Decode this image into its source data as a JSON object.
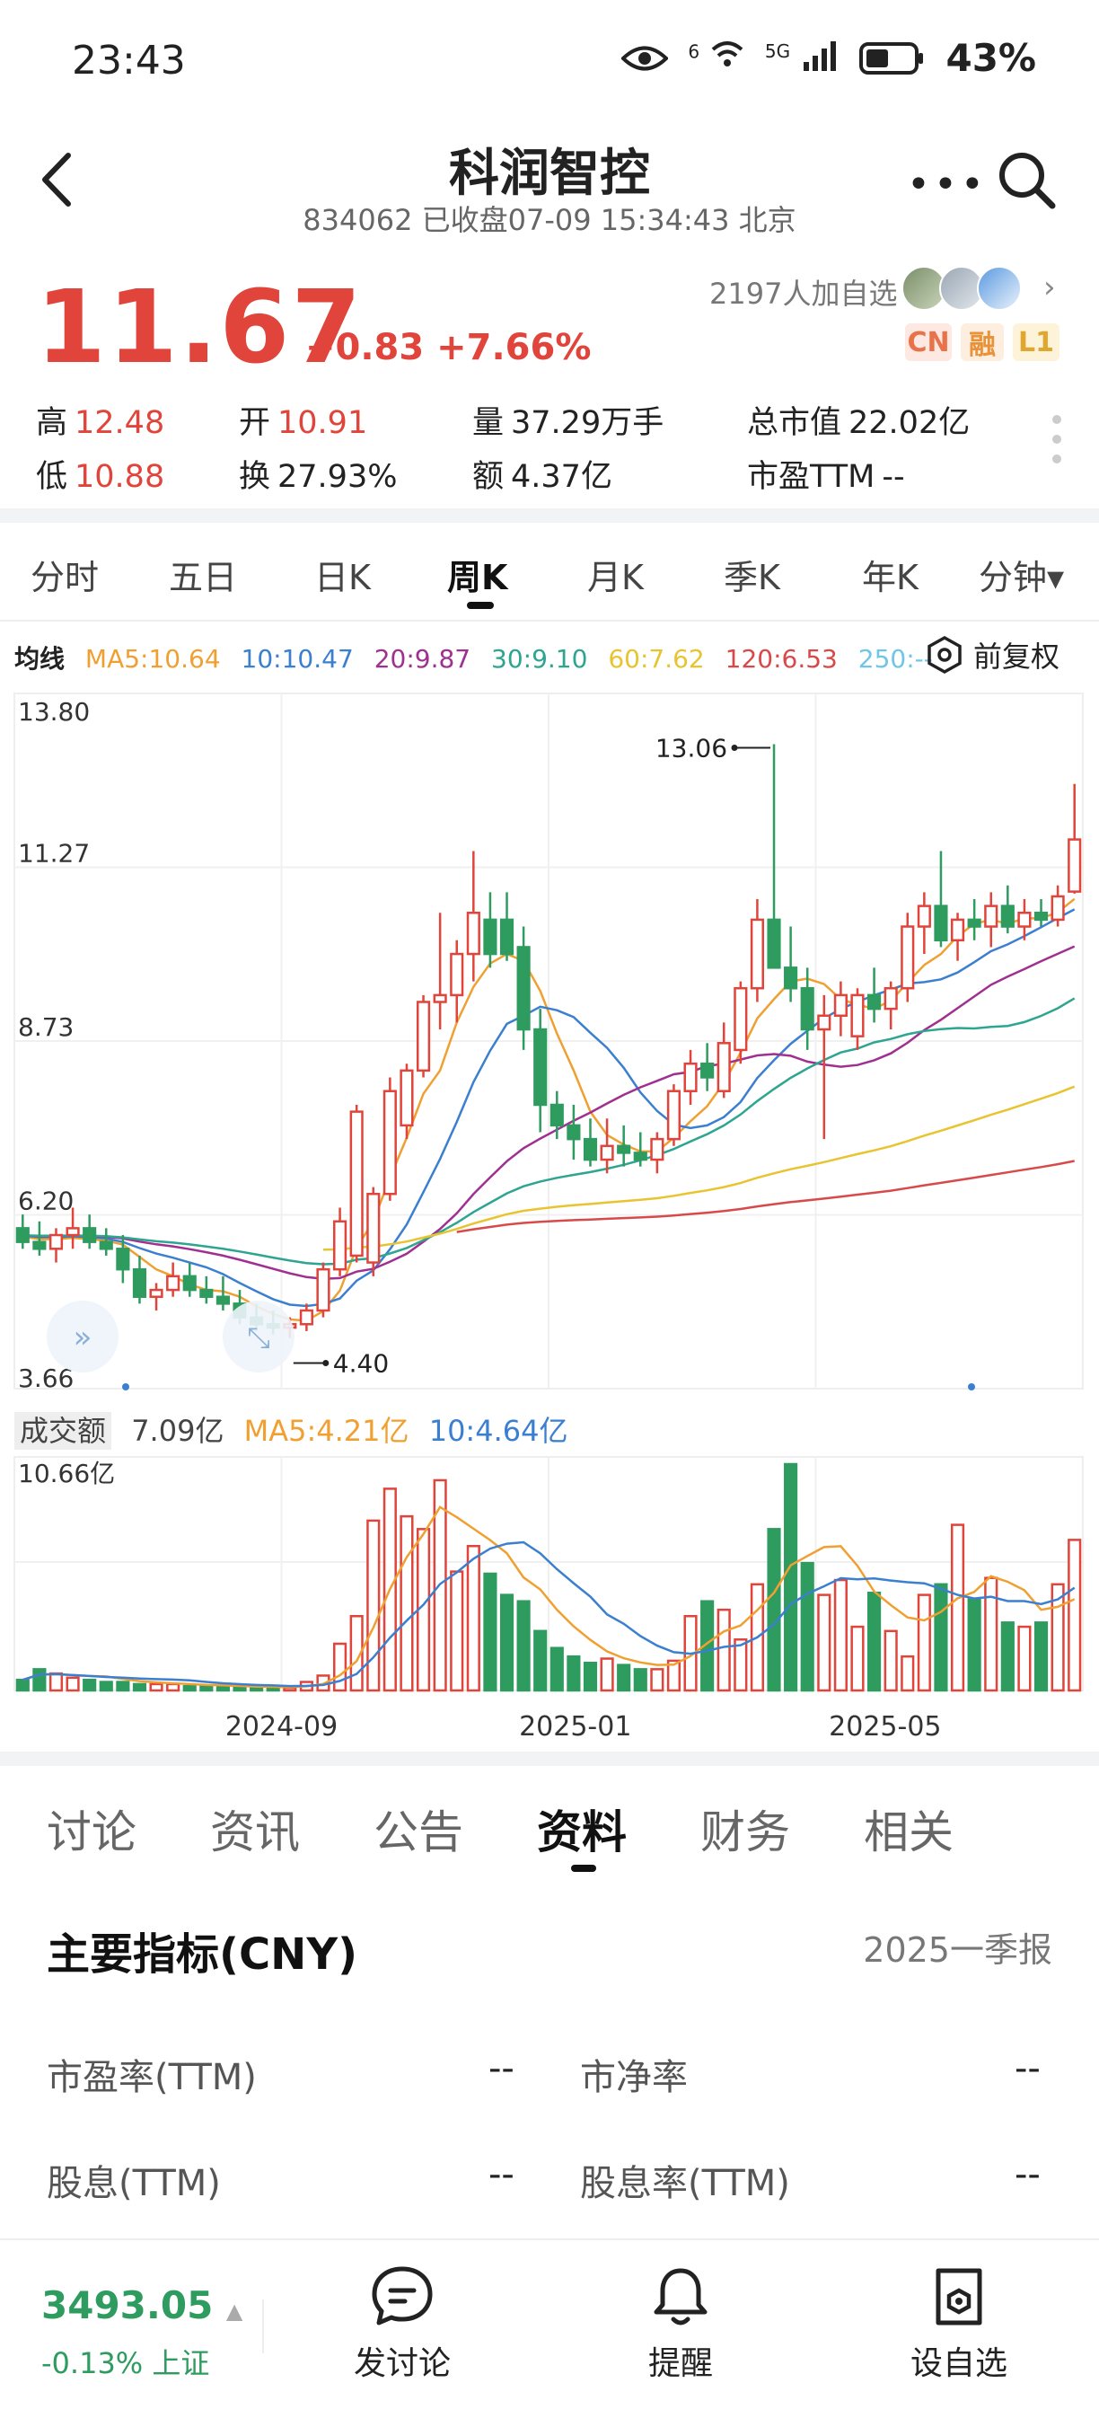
{
  "status_bar": {
    "time": "23:43",
    "battery": "43%",
    "network": "5G",
    "wifi_tag": "6"
  },
  "header": {
    "title": "科润智控",
    "subtitle": "834062 已收盘07-09 15:34:43 北京"
  },
  "quote": {
    "price": "11.67",
    "change": "+0.83 +7.66%",
    "followers": "2197人加自选",
    "tags": [
      "CN",
      "融",
      "L1"
    ],
    "stats": {
      "high_label": "高",
      "high": "12.48",
      "low_label": "低",
      "low": "10.88",
      "open_label": "开",
      "open": "10.91",
      "turnover_label": "换",
      "turnover": "27.93%",
      "volume_label": "量",
      "volume": "37.29万手",
      "amount_label": "额",
      "amount": "4.37亿",
      "mktcap_label": "总市值",
      "mktcap": "22.02亿",
      "pe_label": "市盈TTM",
      "pe": "--"
    }
  },
  "period_tabs": [
    "分时",
    "五日",
    "日K",
    "周K",
    "月K",
    "季K",
    "年K",
    "分钟▾"
  ],
  "active_period": "周K",
  "ma_legend": {
    "title": "均线",
    "items": [
      {
        "label": "MA5:10.64",
        "color": "#f0a030"
      },
      {
        "label": "10:10.47",
        "color": "#3b7fd0"
      },
      {
        "label": "20:9.87",
        "color": "#a03090"
      },
      {
        "label": "30:9.10",
        "color": "#2ea590"
      },
      {
        "label": "60:7.62",
        "color": "#e8c430"
      },
      {
        "label": "120:6.53",
        "color": "#d84a4a"
      },
      {
        "label": "250:--",
        "color": "#6fc6e6"
      }
    ],
    "adjust": "前复权"
  },
  "volume_legend": {
    "title": "成交额",
    "value": "7.09亿",
    "ma5": "MA5:4.21亿",
    "ma10": "10:4.64亿",
    "max_label": "10.66亿"
  },
  "chart_data": {
    "type": "candlestick",
    "price_axis": {
      "ticks": [
        "13.80",
        "11.27",
        "8.73",
        "6.20",
        "3.66"
      ],
      "ylim": [
        3.66,
        13.8
      ]
    },
    "x_ticks": [
      "2024-09",
      "2025-01",
      "2025-05"
    ],
    "annotations": {
      "max": "13.06",
      "min": "4.40"
    },
    "candles": [
      [
        6.0,
        6.2,
        5.7,
        5.8
      ],
      [
        5.8,
        6.1,
        5.6,
        5.7
      ],
      [
        5.7,
        6.0,
        5.5,
        5.9
      ],
      [
        5.9,
        6.3,
        5.7,
        6.0
      ],
      [
        6.0,
        6.2,
        5.7,
        5.8
      ],
      [
        5.8,
        6.0,
        5.6,
        5.7
      ],
      [
        5.7,
        5.9,
        5.2,
        5.4
      ],
      [
        5.4,
        5.6,
        4.9,
        5.0
      ],
      [
        5.0,
        5.2,
        4.8,
        5.1
      ],
      [
        5.1,
        5.5,
        5.0,
        5.3
      ],
      [
        5.3,
        5.5,
        5.0,
        5.1
      ],
      [
        5.1,
        5.3,
        4.9,
        5.0
      ],
      [
        5.0,
        5.3,
        4.8,
        4.9
      ],
      [
        4.9,
        5.1,
        4.6,
        4.7
      ],
      [
        4.7,
        4.9,
        4.5,
        4.6
      ],
      [
        4.6,
        4.8,
        4.45,
        4.55
      ],
      [
        4.55,
        4.7,
        4.4,
        4.6
      ],
      [
        4.6,
        4.9,
        4.5,
        4.8
      ],
      [
        4.8,
        5.5,
        4.7,
        5.4
      ],
      [
        5.4,
        6.3,
        5.3,
        6.1
      ],
      [
        5.6,
        7.8,
        5.5,
        7.7
      ],
      [
        5.5,
        6.6,
        5.3,
        6.5
      ],
      [
        6.5,
        8.2,
        6.4,
        8.0
      ],
      [
        7.5,
        8.4,
        7.3,
        8.3
      ],
      [
        8.3,
        9.4,
        8.2,
        9.3
      ],
      [
        9.3,
        10.6,
        8.9,
        9.4
      ],
      [
        9.4,
        10.2,
        9.0,
        10.0
      ],
      [
        10.0,
        11.5,
        9.6,
        10.6
      ],
      [
        10.5,
        10.9,
        9.8,
        10.0
      ],
      [
        10.5,
        10.9,
        9.9,
        10.0
      ],
      [
        10.1,
        10.4,
        8.6,
        8.9
      ],
      [
        8.9,
        9.2,
        7.4,
        7.8
      ],
      [
        7.8,
        8.0,
        7.3,
        7.5
      ],
      [
        7.5,
        7.8,
        7.0,
        7.3
      ],
      [
        7.3,
        7.6,
        6.9,
        7.0
      ],
      [
        7.0,
        7.6,
        6.8,
        7.2
      ],
      [
        7.2,
        7.5,
        6.9,
        7.1
      ],
      [
        7.1,
        7.4,
        6.9,
        7.0
      ],
      [
        7.0,
        7.4,
        6.8,
        7.3
      ],
      [
        7.3,
        8.1,
        7.2,
        8.0
      ],
      [
        8.0,
        8.6,
        7.8,
        8.4
      ],
      [
        8.4,
        8.7,
        8.0,
        8.2
      ],
      [
        8.0,
        9.0,
        7.9,
        8.7
      ],
      [
        8.6,
        9.6,
        8.4,
        9.5
      ],
      [
        9.5,
        10.8,
        9.3,
        10.5
      ],
      [
        10.5,
        13.06,
        9.9,
        9.8
      ],
      [
        9.8,
        10.4,
        9.3,
        9.5
      ],
      [
        9.5,
        9.8,
        8.6,
        8.9
      ],
      [
        8.9,
        9.4,
        7.3,
        9.1
      ],
      [
        9.1,
        9.6,
        8.8,
        9.4
      ],
      [
        8.8,
        9.5,
        8.6,
        9.4
      ],
      [
        9.4,
        9.8,
        9.0,
        9.2
      ],
      [
        9.2,
        9.6,
        8.9,
        9.5
      ],
      [
        9.5,
        10.6,
        9.3,
        10.4
      ],
      [
        10.4,
        10.9,
        10.0,
        10.7
      ],
      [
        10.7,
        11.5,
        10.1,
        10.2
      ],
      [
        10.2,
        10.6,
        9.9,
        10.5
      ],
      [
        10.5,
        10.8,
        10.2,
        10.4
      ],
      [
        10.4,
        10.9,
        10.1,
        10.7
      ],
      [
        10.7,
        11.0,
        10.3,
        10.4
      ],
      [
        10.4,
        10.8,
        10.2,
        10.6
      ],
      [
        10.6,
        10.8,
        10.4,
        10.5
      ],
      [
        10.5,
        11.0,
        10.4,
        10.84
      ],
      [
        10.91,
        12.48,
        10.88,
        11.67
      ]
    ],
    "amount": [
      0.5,
      1.0,
      0.8,
      0.6,
      0.5,
      0.4,
      0.4,
      0.3,
      0.3,
      0.3,
      0.2,
      0.2,
      0.2,
      0.15,
      0.15,
      0.15,
      0.12,
      0.4,
      0.7,
      2.2,
      3.5,
      8.0,
      9.5,
      8.2,
      7.6,
      9.9,
      5.6,
      6.8,
      5.5,
      4.5,
      4.2,
      2.8,
      2.0,
      1.6,
      1.3,
      1.5,
      1.2,
      1.0,
      1.0,
      1.4,
      3.5,
      4.2,
      3.8,
      2.4,
      5.0,
      7.6,
      10.66,
      6.0,
      4.5,
      5.2,
      3.0,
      4.6,
      2.8,
      1.6,
      4.5,
      5.0,
      7.8,
      4.3,
      5.3,
      3.2,
      3.0,
      3.2,
      5.0,
      7.09
    ]
  },
  "content_tabs": [
    "讨论",
    "资讯",
    "公告",
    "资料",
    "财务",
    "相关"
  ],
  "active_content_tab": "资料",
  "section": {
    "title": "主要指标(CNY)",
    "report": "2025一季报",
    "metrics": [
      {
        "label": "市盈率(TTM)",
        "value": "--"
      },
      {
        "label": "市净率",
        "value": "--"
      },
      {
        "label": "股息(TTM)",
        "value": "--"
      },
      {
        "label": "股息率(TTM)",
        "value": "--"
      }
    ]
  },
  "bottom_bar": {
    "index_value": "3493.05",
    "index_change": "-0.13% 上证",
    "buttons": [
      "发讨论",
      "提醒",
      "设自选"
    ]
  },
  "colors": {
    "up": "#e0443a",
    "down": "#2e9b5f"
  }
}
